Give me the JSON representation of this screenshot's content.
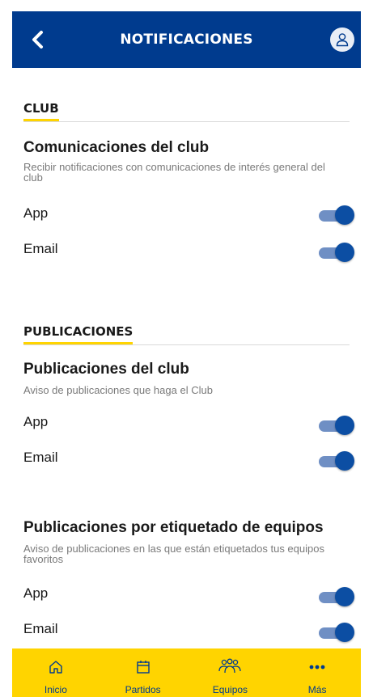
{
  "header": {
    "title": "NOTIFICACIONES"
  },
  "sections": [
    {
      "title": "CLUB",
      "groups": [
        {
          "title": "Comunicaciones del club",
          "description": "Recibir notificaciones con comunicaciones de interés general del club",
          "options": [
            {
              "label": "App",
              "enabled": true
            },
            {
              "label": "Email",
              "enabled": true
            }
          ]
        }
      ]
    },
    {
      "title": "PUBLICACIONES",
      "groups": [
        {
          "title": "Publicaciones del club",
          "description": "Aviso de publicaciones que haga el Club",
          "options": [
            {
              "label": "App",
              "enabled": true
            },
            {
              "label": "Email",
              "enabled": true
            }
          ]
        },
        {
          "title": "Publicaciones por etiquetado de equipos",
          "description": "Aviso de publicaciones en las que están etiquetados tus equipos favoritos",
          "options": [
            {
              "label": "App",
              "enabled": true
            },
            {
              "label": "Email",
              "enabled": true
            }
          ]
        }
      ]
    }
  ],
  "bottom_nav": [
    {
      "label": "Inicio",
      "icon": "home-icon"
    },
    {
      "label": "Partidos",
      "icon": "calendar-icon"
    },
    {
      "label": "Equipos",
      "icon": "team-icon"
    },
    {
      "label": "Más",
      "icon": "more-icon"
    }
  ],
  "colors": {
    "header_bg": "#003b8e",
    "accent_yellow": "#ffd400",
    "toggle_on": "#0c4ea3"
  }
}
